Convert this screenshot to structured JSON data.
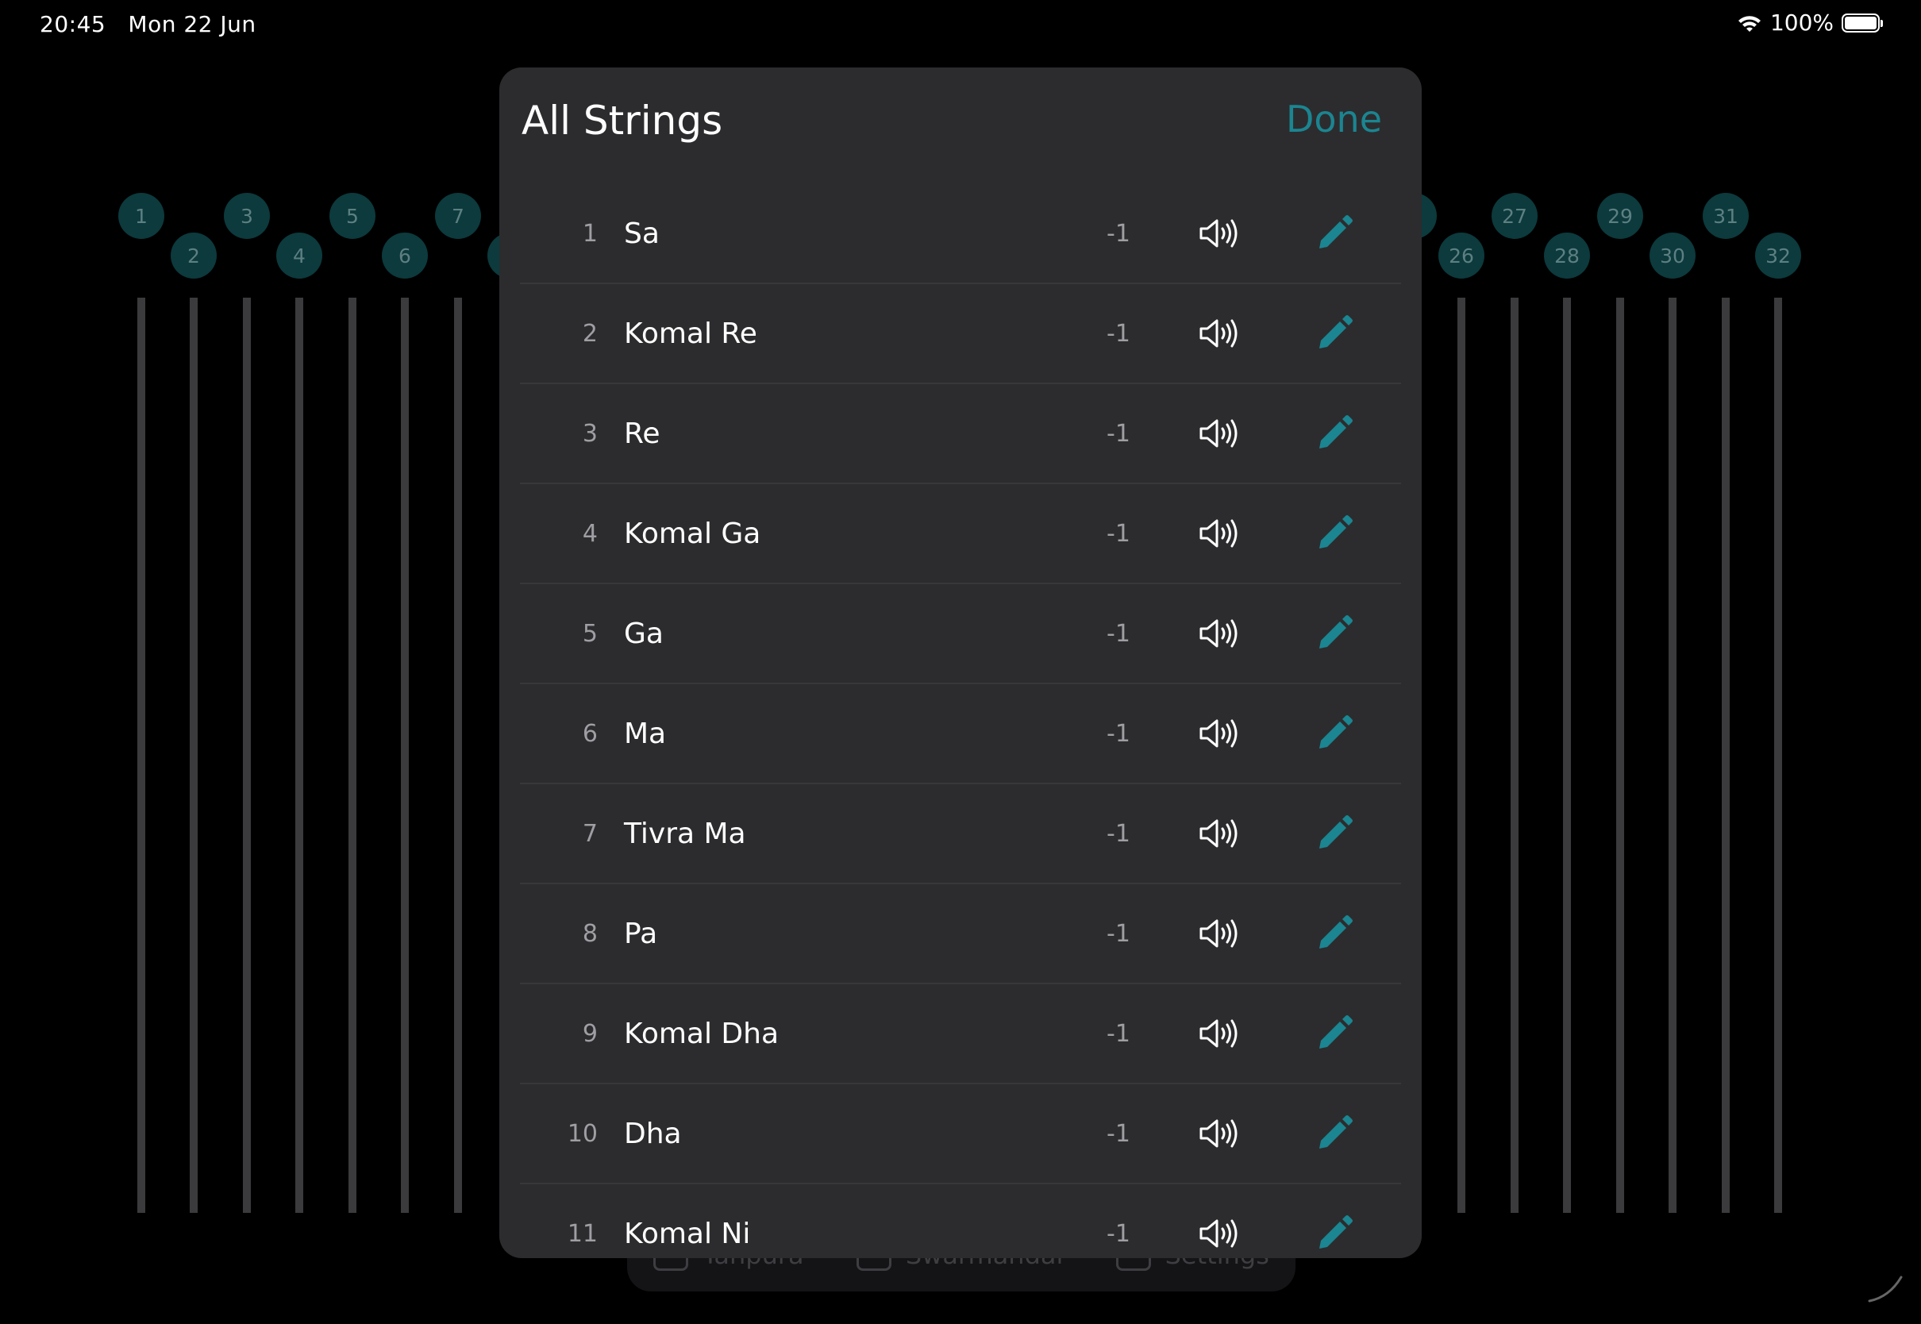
{
  "status_bar": {
    "time": "20:45",
    "date": "Mon 22 Jun",
    "battery": "100%"
  },
  "background": {
    "string_numbers_left": [
      "1",
      "2",
      "3",
      "4",
      "5",
      "6",
      "7"
    ],
    "string_numbers_right": [
      "26",
      "27",
      "28",
      "29",
      "30",
      "31",
      "32"
    ],
    "tabs": [
      {
        "label": "Tanpura"
      },
      {
        "label": "Swarmandal"
      },
      {
        "label": "Settings"
      }
    ]
  },
  "modal": {
    "title": "All Strings",
    "done_label": "Done",
    "accent_color": "#1b8591",
    "rows": [
      {
        "number": "1",
        "name": "Sa",
        "octave": "-1"
      },
      {
        "number": "2",
        "name": "Komal Re",
        "octave": "-1"
      },
      {
        "number": "3",
        "name": "Re",
        "octave": "-1"
      },
      {
        "number": "4",
        "name": "Komal Ga",
        "octave": "-1"
      },
      {
        "number": "5",
        "name": "Ga",
        "octave": "-1"
      },
      {
        "number": "6",
        "name": "Ma",
        "octave": "-1"
      },
      {
        "number": "7",
        "name": "Tivra Ma",
        "octave": "-1"
      },
      {
        "number": "8",
        "name": "Pa",
        "octave": "-1"
      },
      {
        "number": "9",
        "name": "Komal Dha",
        "octave": "-1"
      },
      {
        "number": "10",
        "name": "Dha",
        "octave": "-1"
      },
      {
        "number": "11",
        "name": "Komal Ni",
        "octave": "-1"
      }
    ]
  }
}
